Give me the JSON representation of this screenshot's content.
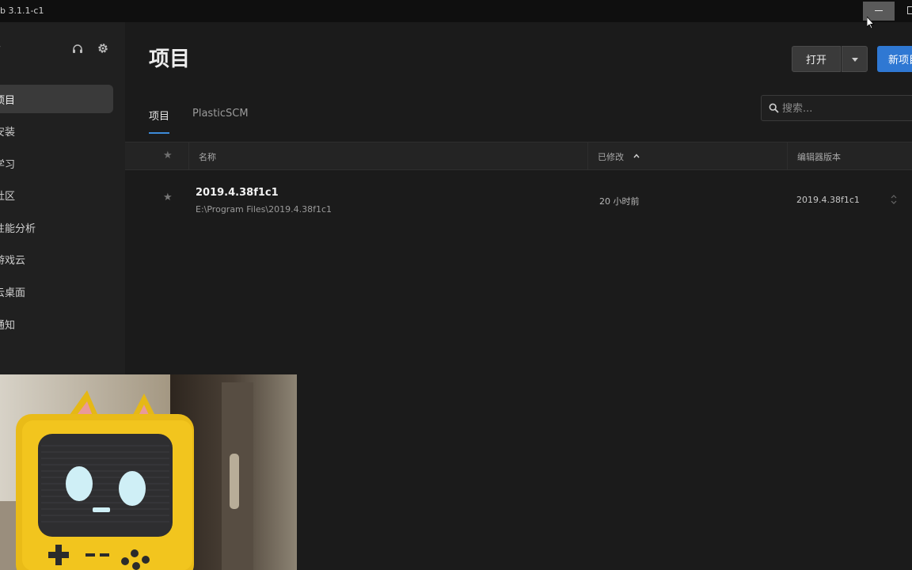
{
  "window": {
    "title_fragment": "b 3.1.1-c1"
  },
  "sidebar": {
    "items": [
      {
        "label": "项目",
        "active": true
      },
      {
        "label": "安装"
      },
      {
        "label": "学习"
      },
      {
        "label": "社区"
      },
      {
        "label": "性能分析"
      },
      {
        "label": "游戏云"
      },
      {
        "label": "云桌面"
      },
      {
        "label": "通知"
      }
    ]
  },
  "header": {
    "title": "项目",
    "open_label": "打开",
    "new_label": "新项目"
  },
  "tabs": [
    {
      "label": "项目",
      "active": true
    },
    {
      "label": "PlasticSCM"
    }
  ],
  "search": {
    "placeholder": "搜索..."
  },
  "table": {
    "headers": {
      "name": "名称",
      "modified": "已修改",
      "editor": "编辑器版本"
    },
    "rows": [
      {
        "name": "2019.4.38f1c1",
        "path": "E:\\Program Files\\2019.4.38f1c1",
        "modified": "20 小时前",
        "editor_version": "2019.4.38f1c1"
      }
    ]
  },
  "colors": {
    "accent": "#2f78d3",
    "tab_underline": "#3d8ad8",
    "background": "#1b1b1b",
    "sidebar": "#202020",
    "active_item": "#3a3a3a"
  }
}
